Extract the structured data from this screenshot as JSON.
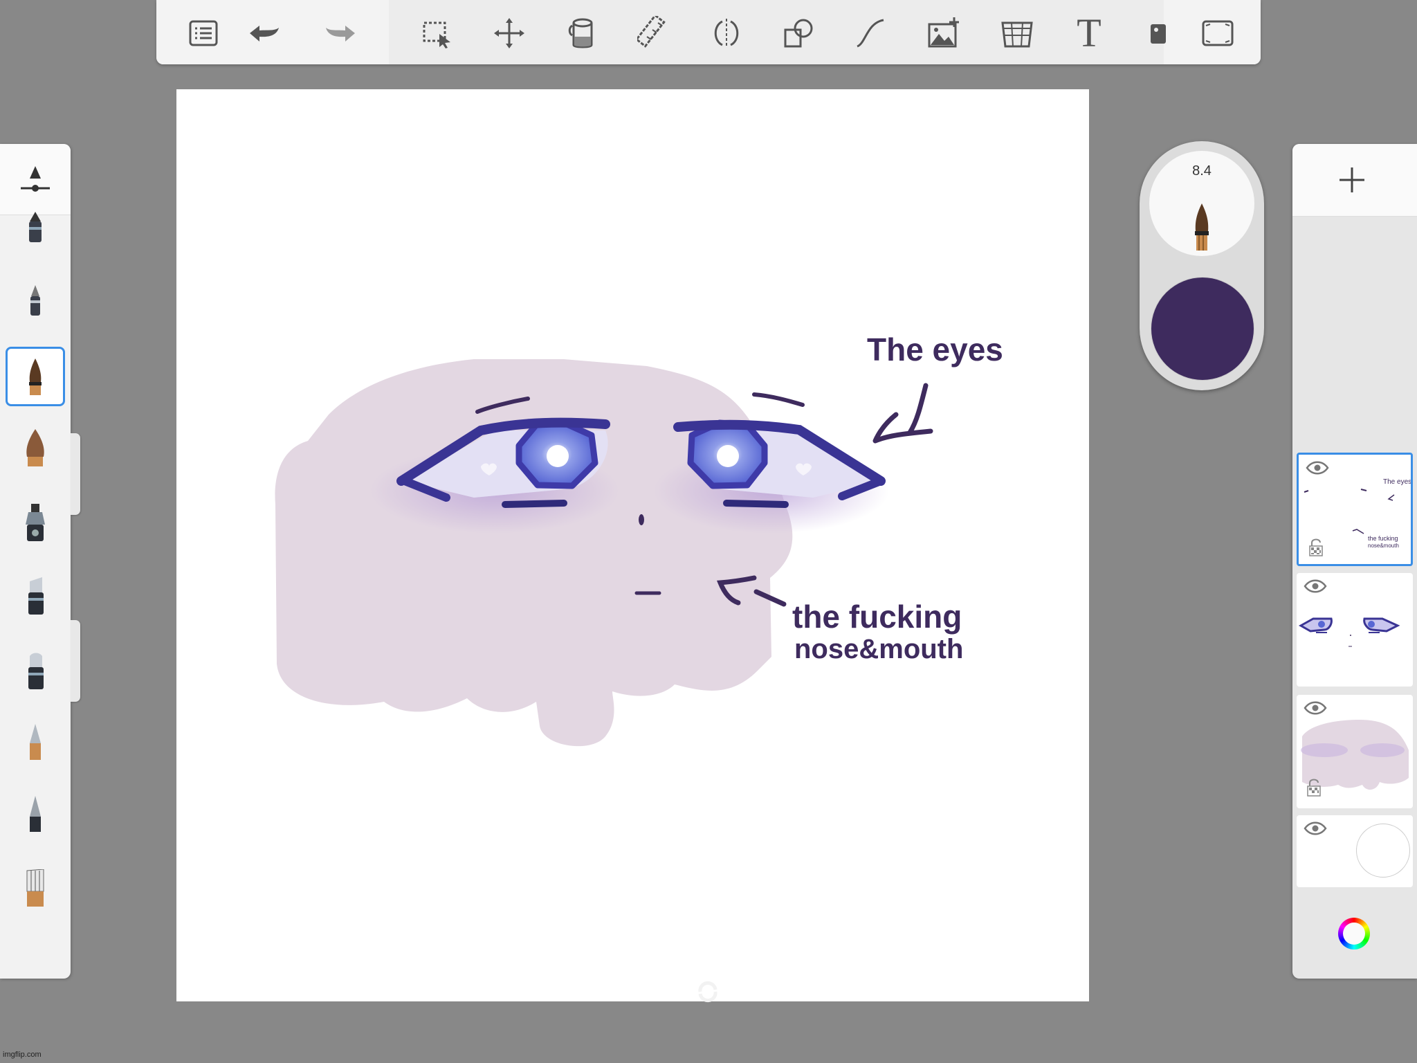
{
  "toolbar": {
    "icons": [
      "list-icon",
      "undo-icon",
      "redo-icon",
      "selection-icon",
      "transform-icon",
      "fill-icon",
      "ruler-icon",
      "symmetry-icon",
      "shapes-icon",
      "curve-icon",
      "import-image-icon",
      "perspective-icon",
      "text-icon",
      "flipbook-icon",
      "fullscreen-icon"
    ]
  },
  "brushes": [
    "pencil",
    "fineliner",
    "ink-brush",
    "paint-brush",
    "airbrush",
    "marker",
    "chisel-marker",
    "soft-pencil",
    "hard-pencil",
    "flat-brush"
  ],
  "selected_brush_index": 2,
  "puck": {
    "brush_size": "8.4",
    "color": "#3e2b5e"
  },
  "canvas": {
    "annotation_eyes": "The eyes",
    "annotation_mouth_line1": "the fucking",
    "annotation_mouth_line2": "nose&mouth",
    "face_color": "#e3d7e2",
    "ink_color": "#3e2b5e"
  },
  "layers": {
    "add_label": "+",
    "thumb_text_eyes": "The eyes",
    "thumb_text_line1": "the fucking",
    "thumb_text_line2": "nose&mouth"
  },
  "watermark": "imgflip.com"
}
